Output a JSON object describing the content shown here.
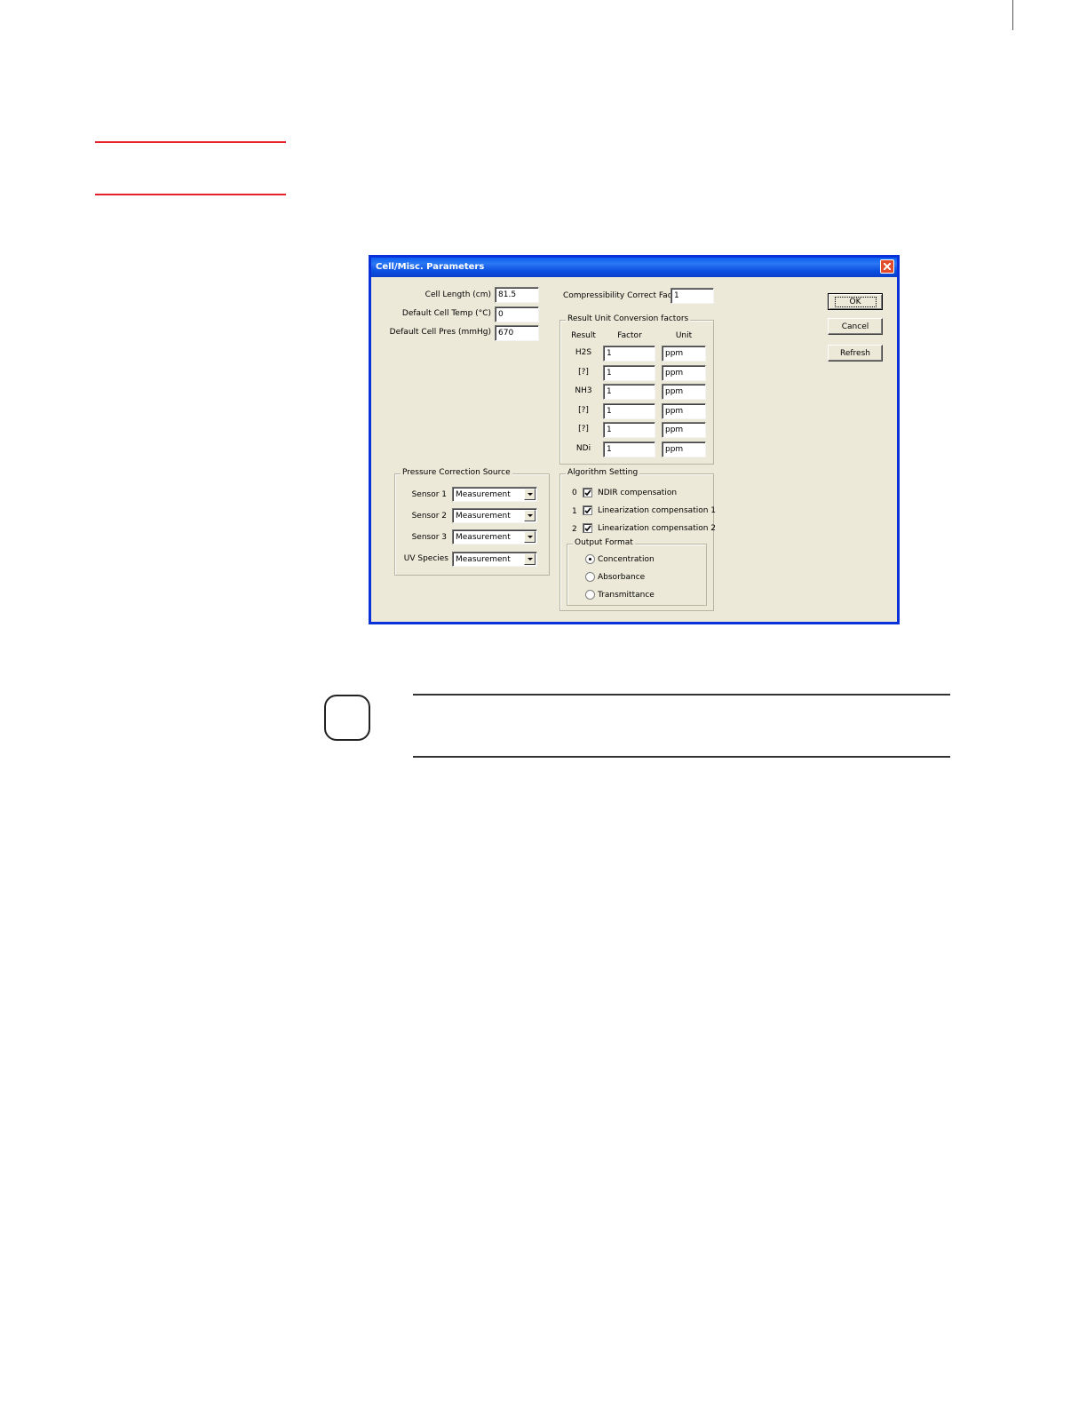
{
  "dialog": {
    "title": "Cell/Misc. Parameters",
    "cell_length": {
      "label": "Cell Length (cm)",
      "value": "81.5"
    },
    "default_cell_temp": {
      "label": "Default Cell Temp (°C)",
      "value": "0"
    },
    "default_cell_pres": {
      "label": "Default Cell Pres (mmHg)",
      "value": "670"
    },
    "compressibility": {
      "label": "Compressibility Correct Factor",
      "value": "1"
    },
    "buttons": {
      "ok": "OK",
      "cancel": "Cancel",
      "refresh": "Refresh"
    },
    "conversion": {
      "title": "Result Unit Conversion factors",
      "headers": {
        "result": "Result",
        "factor": "Factor",
        "unit": "Unit"
      },
      "rows": [
        {
          "result": "H2S",
          "factor": "1",
          "unit": "ppm"
        },
        {
          "result": "[?]",
          "factor": "1",
          "unit": "ppm"
        },
        {
          "result": "NH3",
          "factor": "1",
          "unit": "ppm"
        },
        {
          "result": "[?]",
          "factor": "1",
          "unit": "ppm"
        },
        {
          "result": "[?]",
          "factor": "1",
          "unit": "ppm"
        },
        {
          "result": "NDi",
          "factor": "1",
          "unit": "ppm"
        }
      ]
    },
    "pressure": {
      "title": "Pressure Correction Source",
      "rows": [
        {
          "label": "Sensor 1",
          "value": "Measurement"
        },
        {
          "label": "Sensor 2",
          "value": "Measurement"
        },
        {
          "label": "Sensor 3",
          "value": "Measurement"
        },
        {
          "label": "UV Species",
          "value": "Measurement"
        }
      ]
    },
    "algorithm": {
      "title": "Algorithm Setting",
      "items": [
        {
          "index": "0",
          "label": "NDIR compensation",
          "checked": true
        },
        {
          "index": "1",
          "label": "Linearization compensation 1",
          "checked": true
        },
        {
          "index": "2",
          "label": "Linearization compensation 2",
          "checked": true
        }
      ],
      "output_format": {
        "title": "Output Format",
        "options": [
          {
            "label": "Concentration",
            "selected": true
          },
          {
            "label": "Absorbance",
            "selected": false
          },
          {
            "label": "Transmittance",
            "selected": false
          }
        ]
      }
    }
  }
}
